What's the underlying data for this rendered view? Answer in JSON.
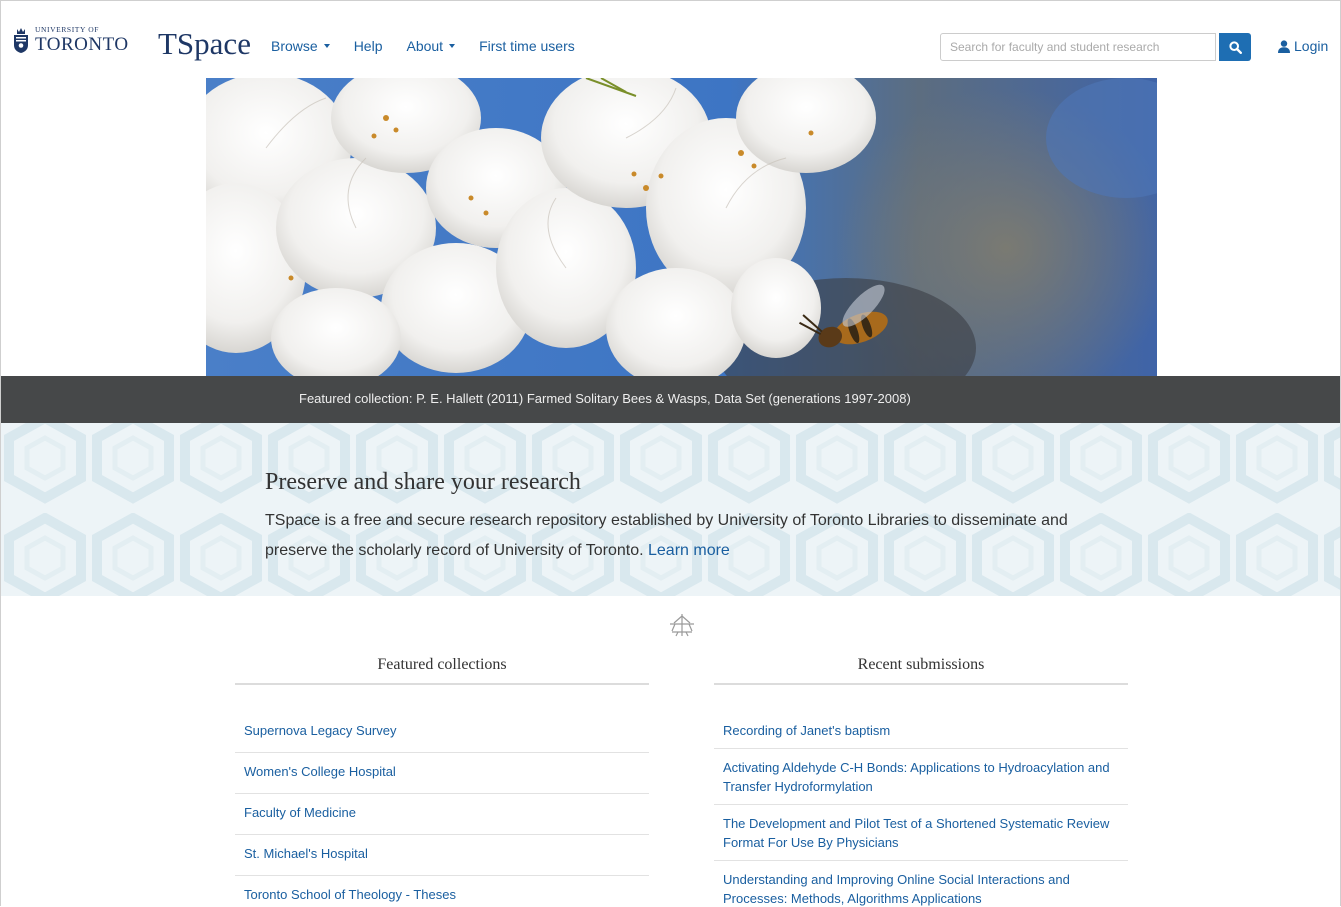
{
  "header": {
    "uoft_small": "UNIVERSITY OF",
    "uoft_big": "TORONTO",
    "brand": "TSpace",
    "nav": [
      {
        "label": "Browse",
        "dropdown": true
      },
      {
        "label": "Help",
        "dropdown": false
      },
      {
        "label": "About",
        "dropdown": true
      },
      {
        "label": "First time users",
        "dropdown": false
      }
    ],
    "search_placeholder": "Search for faculty and student research",
    "login_label": "Login"
  },
  "hero": {
    "caption": "Featured collection: P. E. Hallett (2011) Farmed Solitary Bees & Wasps, Data Set (generations 1997-2008)"
  },
  "intro": {
    "title": "Preserve and share your research",
    "text": "TSpace is a free and secure research repository established by University of Toronto Libraries to disseminate and preserve the scholarly record of University of Toronto.",
    "learn_more": "Learn more"
  },
  "featured": {
    "heading": "Featured collections",
    "items": [
      "Supernova Legacy Survey",
      "Women's College Hospital",
      "Faculty of Medicine",
      "St. Michael's Hospital",
      "Toronto School of Theology - Theses"
    ]
  },
  "recent": {
    "heading": "Recent submissions",
    "items": [
      "Recording of Janet's baptism",
      "Activating Aldehyde C-H Bonds: Applications to Hydroacylation and Transfer Hydroformylation",
      "The Development and Pilot Test of a Shortened Systematic Review Format For Use By Physicians",
      "Understanding and Improving Online Social Interactions and Processes: Methods, Algorithms Applications"
    ]
  },
  "colors": {
    "link": "#1a5fa0",
    "brand": "#1e3765",
    "caption_bar": "#464849",
    "search_button": "#1e6eb3",
    "intro_bg": "#edf4f7"
  }
}
